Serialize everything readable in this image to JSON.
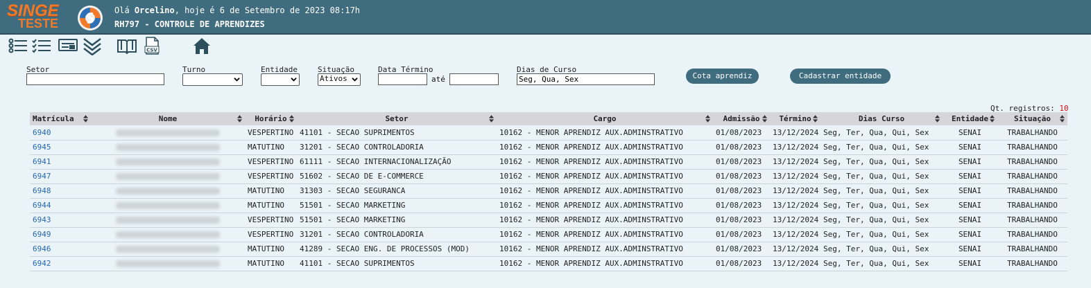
{
  "header": {
    "logo_main": "SINGE",
    "logo_sub": "TESTE",
    "greeting_prefix": "Olá ",
    "user_name": "Orcelino",
    "greeting_suffix": ", hoje é 6 de Setembro de 2023 08:17h",
    "screen_title": "RH797 - CONTROLE DE APRENDIZES",
    "accent_color": "#f07a2a",
    "bar_color": "#3f6c7e"
  },
  "toolbar": {
    "icons": [
      "list-icon",
      "checklist-icon",
      "form-icon",
      "collapse-icon",
      "manual-icon",
      "csv-export-icon",
      "home-icon"
    ],
    "csv_label": "CSV"
  },
  "filters": {
    "setor_label": "Setor",
    "setor_value": "",
    "turno_label": "Turno",
    "turno_value": "",
    "entidade_label": "Entidade",
    "entidade_value": "",
    "situacao_label": "Situação",
    "situacao_value": "Ativos",
    "data_termino_label": "Data Término",
    "data_termino_from": "",
    "ate_label": "até",
    "data_termino_to": "",
    "dias_curso_label": "Dias de Curso",
    "dias_curso_value": "Seg, Qua, Sex",
    "cota_button": "Cota aprendiz",
    "cadastrar_button": "Cadastrar entidade"
  },
  "records": {
    "count_label": "Qt. registros:",
    "count": "10"
  },
  "table": {
    "columns": [
      "Matrícula",
      "Nome",
      "Horário",
      "Setor",
      "Cargo",
      "Admissão",
      "Término",
      "Dias Curso",
      "Entidade",
      "Situação"
    ],
    "rows": [
      {
        "matricula": "6940",
        "nome": "",
        "horario": "VESPERTINO",
        "setor": "41101 - SECAO SUPRIMENTOS",
        "cargo": "10162 - MENOR APRENDIZ AUX.ADMINSTRATIVO",
        "admissao": "01/08/2023",
        "termino": "13/12/2024",
        "dias": "Seg, Ter, Qua, Qui, Sex",
        "entidade": "SENAI",
        "situacao": "TRABALHANDO"
      },
      {
        "matricula": "6945",
        "nome": "",
        "horario": "MATUTINO",
        "setor": "31201 - SECAO CONTROLADORIA",
        "cargo": "10162 - MENOR APRENDIZ AUX.ADMINSTRATIVO",
        "admissao": "01/08/2023",
        "termino": "13/12/2024",
        "dias": "Seg, Ter, Qua, Qui, Sex",
        "entidade": "SENAI",
        "situacao": "TRABALHANDO"
      },
      {
        "matricula": "6941",
        "nome": "",
        "horario": "VESPERTINO",
        "setor": "61111 - SECAO INTERNACIONALIZAÇÃO",
        "cargo": "10162 - MENOR APRENDIZ AUX.ADMINSTRATIVO",
        "admissao": "01/08/2023",
        "termino": "13/12/2024",
        "dias": "Seg, Ter, Qua, Qui, Sex",
        "entidade": "SENAI",
        "situacao": "TRABALHANDO"
      },
      {
        "matricula": "6947",
        "nome": "",
        "horario": "VESPERTINO",
        "setor": "51602 - SECAO DE E-COMMERCE",
        "cargo": "10162 - MENOR APRENDIZ AUX.ADMINSTRATIVO",
        "admissao": "01/08/2023",
        "termino": "13/12/2024",
        "dias": "Seg, Ter, Qua, Qui, Sex",
        "entidade": "SENAI",
        "situacao": "TRABALHANDO"
      },
      {
        "matricula": "6948",
        "nome": "",
        "horario": "MATUTINO",
        "setor": "31303 - SECAO SEGURANCA",
        "cargo": "10162 - MENOR APRENDIZ AUX.ADMINSTRATIVO",
        "admissao": "01/08/2023",
        "termino": "13/12/2024",
        "dias": "Seg, Ter, Qua, Qui, Sex",
        "entidade": "SENAI",
        "situacao": "TRABALHANDO"
      },
      {
        "matricula": "6944",
        "nome": "",
        "horario": "MATUTINO",
        "setor": "51501 - SECAO MARKETING",
        "cargo": "10162 - MENOR APRENDIZ AUX.ADMINSTRATIVO",
        "admissao": "01/08/2023",
        "termino": "13/12/2024",
        "dias": "Seg, Ter, Qua, Qui, Sex",
        "entidade": "SENAI",
        "situacao": "TRABALHANDO"
      },
      {
        "matricula": "6943",
        "nome": "",
        "horario": "VESPERTINO",
        "setor": "51501 - SECAO MARKETING",
        "cargo": "10162 - MENOR APRENDIZ AUX.ADMINSTRATIVO",
        "admissao": "01/08/2023",
        "termino": "13/12/2024",
        "dias": "Seg, Ter, Qua, Qui, Sex",
        "entidade": "SENAI",
        "situacao": "TRABALHANDO"
      },
      {
        "matricula": "6949",
        "nome": "",
        "horario": "VESPERTINO",
        "setor": "31201 - SECAO CONTROLADORIA",
        "cargo": "10162 - MENOR APRENDIZ AUX.ADMINSTRATIVO",
        "admissao": "01/08/2023",
        "termino": "13/12/2024",
        "dias": "Seg, Ter, Qua, Qui, Sex",
        "entidade": "SENAI",
        "situacao": "TRABALHANDO"
      },
      {
        "matricula": "6946",
        "nome": "",
        "horario": "MATUTINO",
        "setor": "41289 - SECAO ENG. DE PROCESSOS (MOD)",
        "cargo": "10162 - MENOR APRENDIZ AUX.ADMINSTRATIVO",
        "admissao": "01/08/2023",
        "termino": "13/12/2024",
        "dias": "Seg, Ter, Qua, Qui, Sex",
        "entidade": "SENAI",
        "situacao": "TRABALHANDO"
      },
      {
        "matricula": "6942",
        "nome": "",
        "horario": "MATUTINO",
        "setor": "41101 - SECAO SUPRIMENTOS",
        "cargo": "10162 - MENOR APRENDIZ AUX.ADMINSTRATIVO",
        "admissao": "01/08/2023",
        "termino": "13/12/2024",
        "dias": "Seg, Ter, Qua, Qui, Sex",
        "entidade": "SENAI",
        "situacao": "TRABALHANDO"
      }
    ]
  }
}
